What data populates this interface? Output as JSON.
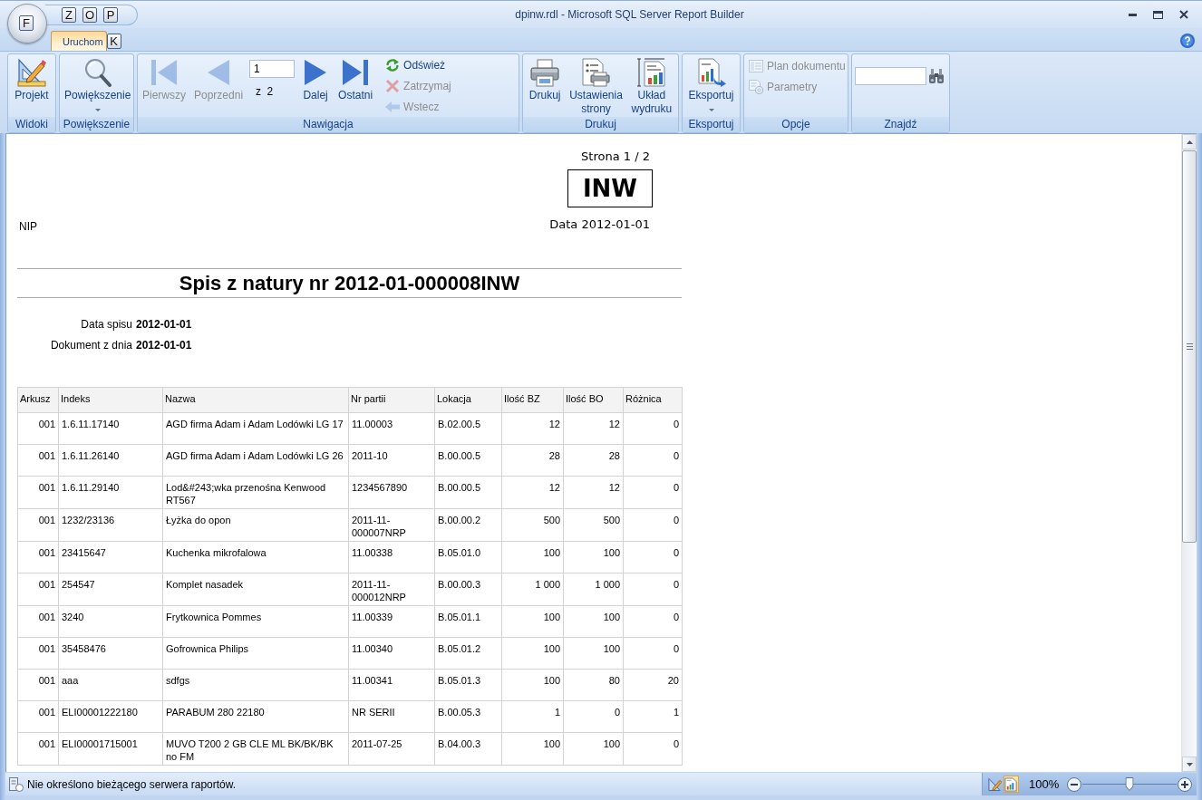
{
  "window": {
    "title": "dpinw.rdl - Microsoft SQL Server Report Builder",
    "app_keytip": "F"
  },
  "quick_access": [
    {
      "keytip": "Z"
    },
    {
      "keytip": "O"
    },
    {
      "keytip": "P"
    }
  ],
  "tabs": [
    {
      "label": "Uruchom",
      "keytip": "K",
      "selected": true
    }
  ],
  "ribbon": [
    {
      "label": "Widoki",
      "items": [
        {
          "kind": "large",
          "label": "Projekt",
          "dropdown": false,
          "disabled": false
        }
      ]
    },
    {
      "label": "Powiększenie",
      "items": [
        {
          "kind": "large",
          "label": "Powiększenie",
          "dropdown": true,
          "disabled": false
        }
      ]
    },
    {
      "label": "Nawigacja",
      "items": [
        {
          "kind": "large",
          "label": "Pierwszy",
          "dropdown": false,
          "disabled": true
        },
        {
          "kind": "large",
          "label": "Poprzedni",
          "dropdown": false,
          "disabled": true
        },
        {
          "kind": "page",
          "value": "1",
          "count": "z 2",
          "disabled": false
        },
        {
          "kind": "large",
          "label": "Dalej",
          "dropdown": false,
          "disabled": false
        },
        {
          "kind": "large",
          "label": "Ostatni",
          "dropdown": false,
          "disabled": false
        },
        {
          "kind": "small",
          "label": "Odśwież",
          "disabled": false
        },
        {
          "kind": "small",
          "label": "Zatrzymaj",
          "disabled": true
        },
        {
          "kind": "small",
          "label": "Wstecz",
          "disabled": true
        }
      ]
    },
    {
      "label": "Drukuj",
      "items": [
        {
          "kind": "large",
          "label": "Drukuj",
          "dropdown": false,
          "disabled": false
        },
        {
          "kind": "large",
          "label": "Ustawienia strony",
          "dropdown": false,
          "disabled": false
        },
        {
          "kind": "large",
          "label": "Układ wydruku",
          "dropdown": false,
          "disabled": false
        }
      ]
    },
    {
      "label": "Eksportuj",
      "items": [
        {
          "kind": "large",
          "label": "Eksportuj",
          "dropdown": true,
          "disabled": false
        }
      ]
    },
    {
      "label": "Opcje",
      "items": [
        {
          "kind": "small",
          "label": "Plan dokumentu",
          "disabled": true
        },
        {
          "kind": "small",
          "label": "Parametry",
          "disabled": true
        }
      ]
    },
    {
      "label": "Znajdź",
      "items": [
        {
          "kind": "search",
          "disabled": false
        }
      ]
    }
  ],
  "report": {
    "page_label": "Strona 1 / 2",
    "code": "INW",
    "date": "Data 2012-01-01",
    "nip": "NIP",
    "title": "Spis z natury nr 2012-01-000008INW",
    "fields": [
      {
        "label": "Data spisu",
        "value": "2012-01-01"
      },
      {
        "label": "Dokument z dnia",
        "value": "2012-01-01"
      }
    ],
    "table": {
      "columns": [
        "Arkusz",
        "Indeks",
        "Nazwa",
        "Nr partii",
        "Lokacja",
        "Ilość BZ",
        "Ilość BO",
        "Różnica"
      ],
      "rows": [
        [
          "001",
          "1.6.11.17140",
          "AGD firma Adam i Adam Lodówki LG 17",
          "11.00003",
          "B.02.00.5",
          "12",
          "12",
          "0"
        ],
        [
          "001",
          "1.6.11.26140",
          "AGD firma Adam i Adam Lodówki LG 26",
          "2011-10",
          "B.00.00.5",
          "28",
          "28",
          "0"
        ],
        [
          "001",
          "1.6.11.29140",
          "Lod&#243;wka przenośna Kenwood RT567",
          "1234567890",
          "B.00.00.5",
          "12",
          "12",
          "0"
        ],
        [
          "001",
          "1232/23136",
          "Łyżka do opon",
          "2011-11-000007NRP",
          "B.00.00.2",
          "500",
          "500",
          "0"
        ],
        [
          "001",
          "23415647",
          "Kuchenka mikrofalowa",
          "11.00338",
          "B.05.01.0",
          "100",
          "100",
          "0"
        ],
        [
          "001",
          "254547",
          "Komplet nasadek",
          "2011-11-000012NRP",
          "B.00.00.3",
          "1 000",
          "1 000",
          "0"
        ],
        [
          "001",
          "3240",
          "Frytkownica Pommes",
          "11.00339",
          "B.05.01.1",
          "100",
          "100",
          "0"
        ],
        [
          "001",
          "35458476",
          "Gofrownica Philips",
          "11.00340",
          "B.05.01.2",
          "100",
          "100",
          "0"
        ],
        [
          "001",
          "aaa",
          "sdfgs",
          "11.00341",
          "B.05.01.3",
          "100",
          "80",
          "20"
        ],
        [
          "001",
          "ELI00001222180",
          "PARABUM 280 22180",
          "NR SERII",
          "B.00.05.3",
          "1",
          "0",
          "1"
        ],
        [
          "001",
          "ELI00001715001",
          "MUVO T200 2 GB CLE ML BK/BK/BK no FM",
          "2011-07-25",
          "B.04.00.3",
          "100",
          "100",
          "0"
        ]
      ]
    }
  },
  "status_bar": {
    "message": "Nie określono bieżącego serwera raportów.",
    "views": [
      {
        "selected": false
      },
      {
        "selected": true
      }
    ],
    "zoom": {
      "reading": "100%",
      "level": 0.5
    }
  }
}
